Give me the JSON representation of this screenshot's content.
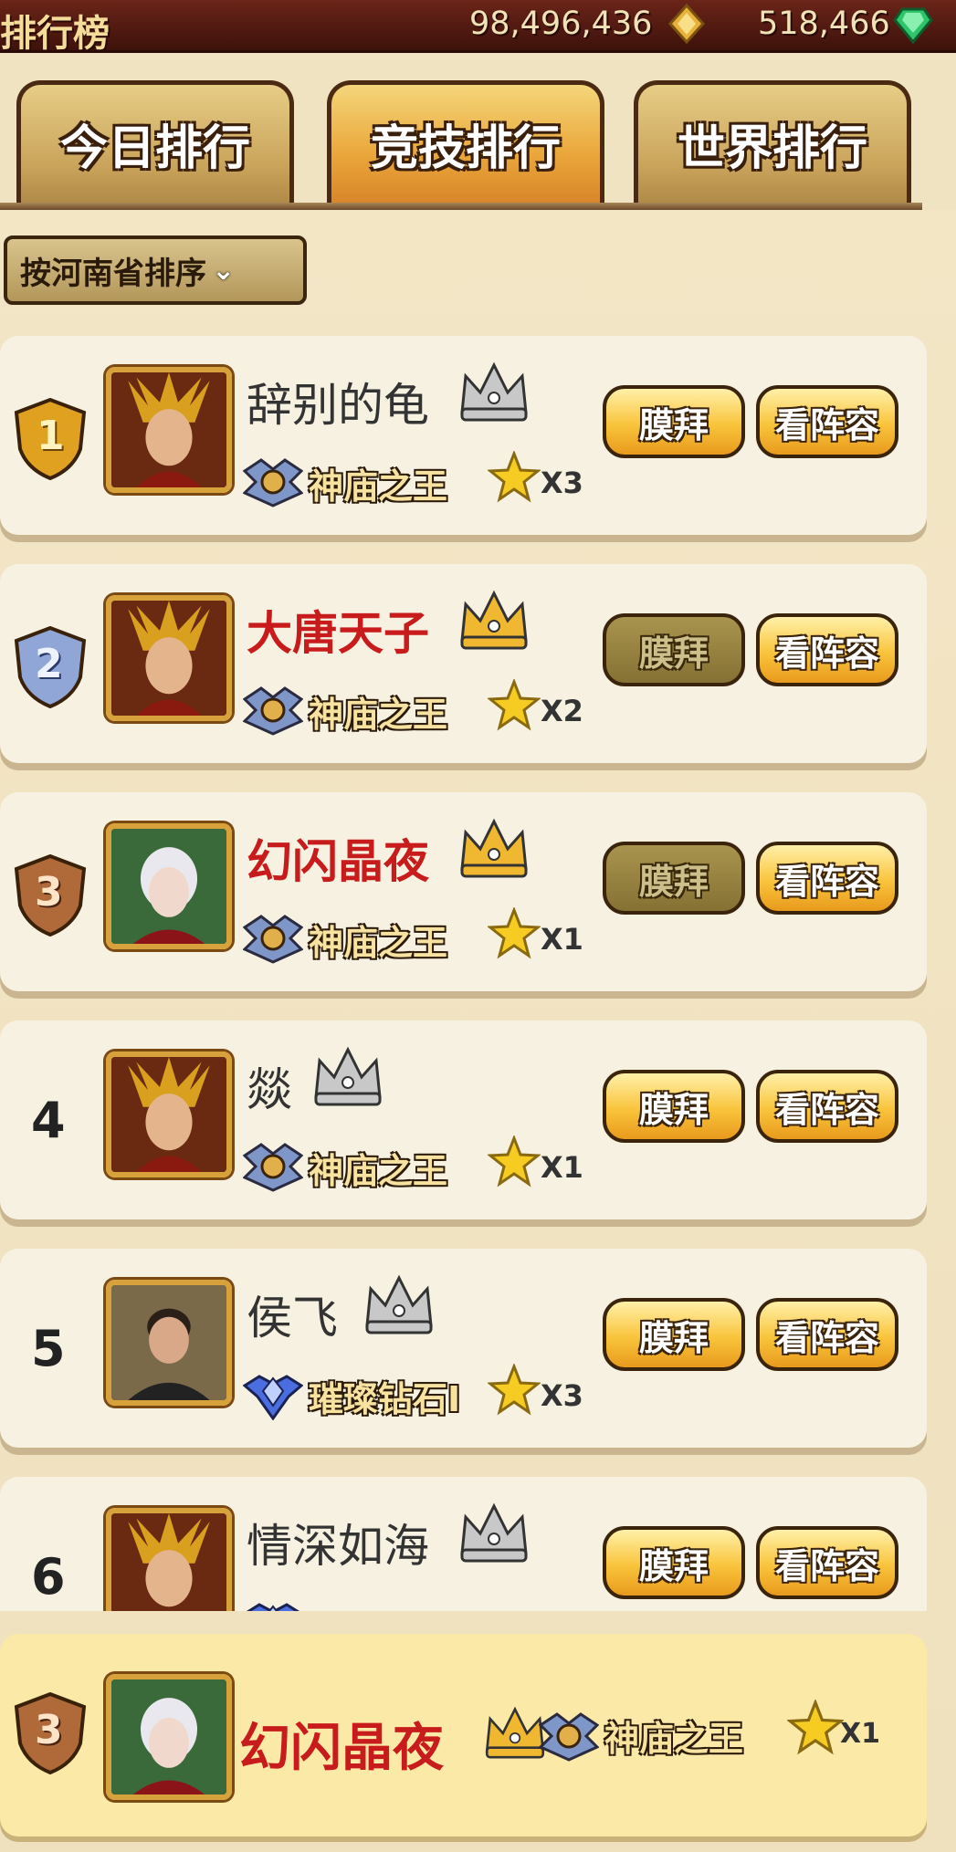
{
  "header": {
    "title": "排行榜",
    "gold": "98,496,436",
    "gems": "518,466"
  },
  "tabs": [
    {
      "label": "今日排行",
      "active": false
    },
    {
      "label": "竞技排行",
      "active": true
    },
    {
      "label": "世界排行",
      "active": false
    }
  ],
  "sort": {
    "label": "按河南省排序"
  },
  "buttons": {
    "worship": "膜拜",
    "lineup": "看阵容"
  },
  "rows": [
    {
      "rank": "1",
      "name": "辞别的龟",
      "league": "神庙之王",
      "stars": "X3",
      "crown": "silver",
      "worship_enabled": true
    },
    {
      "rank": "2",
      "name": "大唐天子",
      "league": "神庙之王",
      "stars": "X2",
      "crown": "gold",
      "worship_enabled": false
    },
    {
      "rank": "3",
      "name": "幻闪晶夜",
      "league": "神庙之王",
      "stars": "X1",
      "crown": "gold",
      "worship_enabled": false
    },
    {
      "rank": "4",
      "name": "燚",
      "league": "神庙之王",
      "stars": "X1",
      "crown": "silver",
      "worship_enabled": true
    },
    {
      "rank": "5",
      "name": "侯飞",
      "league": "璀璨钻石I",
      "stars": "X3",
      "crown": "silver",
      "worship_enabled": true
    },
    {
      "rank": "6",
      "name": "情深如海",
      "league": "",
      "stars": "",
      "crown": "silver",
      "worship_enabled": true
    }
  ],
  "my_rank": {
    "rank": "3",
    "name": "幻闪晶夜",
    "league": "神庙之王",
    "stars": "X1"
  },
  "colors": {
    "gold_badge": "#e0a020",
    "silver_badge": "#8fa6d6",
    "bronze_badge": "#b06a3a",
    "name_red": "#c81c1c"
  }
}
